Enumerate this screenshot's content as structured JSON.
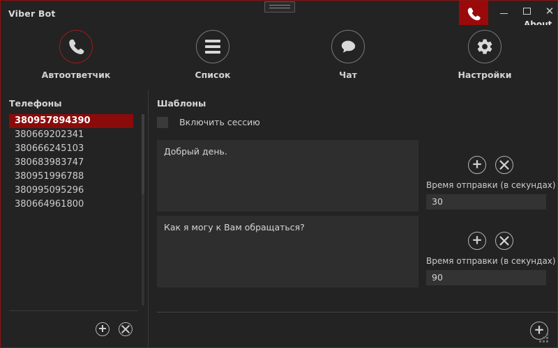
{
  "window": {
    "title": "Viber Bot",
    "brand_icon": "phone-handset-icon",
    "brand_color": "#9b0a0a",
    "accent_color": "#8b0b0b",
    "background": "#232323",
    "about_label": "About",
    "minimize_label": "–",
    "maximize_label": "□",
    "close_label": "✕",
    "grip_icon": "window-grip-icon"
  },
  "nav": {
    "items": [
      {
        "label": "Автоответчик",
        "icon": "phone-handset-icon",
        "active": true
      },
      {
        "label": "Список",
        "icon": "list-menu-icon",
        "active": false
      },
      {
        "label": "Чат",
        "icon": "chat-bubble-icon",
        "active": false
      },
      {
        "label": "Настройки",
        "icon": "gear-icon",
        "active": false
      }
    ]
  },
  "phones_panel": {
    "title": "Телефоны",
    "items": [
      "380957894390",
      "380669202341",
      "380666245103",
      "380683983747",
      "380951996788",
      "380995095296",
      "380664961800"
    ],
    "selected_index": 0,
    "add_label": "+",
    "delete_label": "✕"
  },
  "templates_panel": {
    "title": "Шаблоны",
    "session_checkbox": {
      "label": "Включить сессию",
      "checked": false
    },
    "delay_label": "Время отправки (в секундах)",
    "items": [
      {
        "text": "Добрый день.",
        "delay_label": "Время отправки (в секундах)",
        "delay_value": "30"
      },
      {
        "text": "Как я могу к Вам обращаться?",
        "delay_label": "Время отправки (в секундах)",
        "delay_value": "90"
      }
    ],
    "add_label": "+"
  }
}
